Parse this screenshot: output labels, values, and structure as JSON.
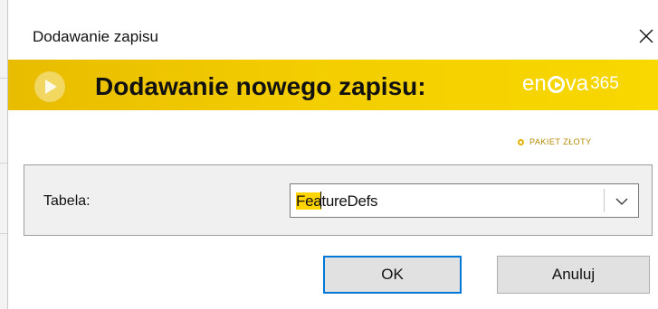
{
  "dialog": {
    "title": "Dodawanie zapisu",
    "close_glyph": "×"
  },
  "banner": {
    "title": "Dodawanie nowego zapisu:",
    "brand_prefix": "en",
    "brand_suffix": "va",
    "brand_number": "365",
    "package": "PAKIET ZŁOTY",
    "colors": {
      "banner": "#f3cd00",
      "brand_text": "#ffffff"
    }
  },
  "form": {
    "label": "Tabela:",
    "combo": {
      "value_highlight": "Fea",
      "value_rest": "tureDefs",
      "highlight_color": "#ffd400"
    }
  },
  "buttons": {
    "ok": "OK",
    "cancel": "Anuluj",
    "focus_color": "#0078d7"
  },
  "icons": [
    "close-icon",
    "play-icon",
    "enova-logo-icon",
    "pakiet-circle-icon",
    "chevron-down-icon"
  ]
}
